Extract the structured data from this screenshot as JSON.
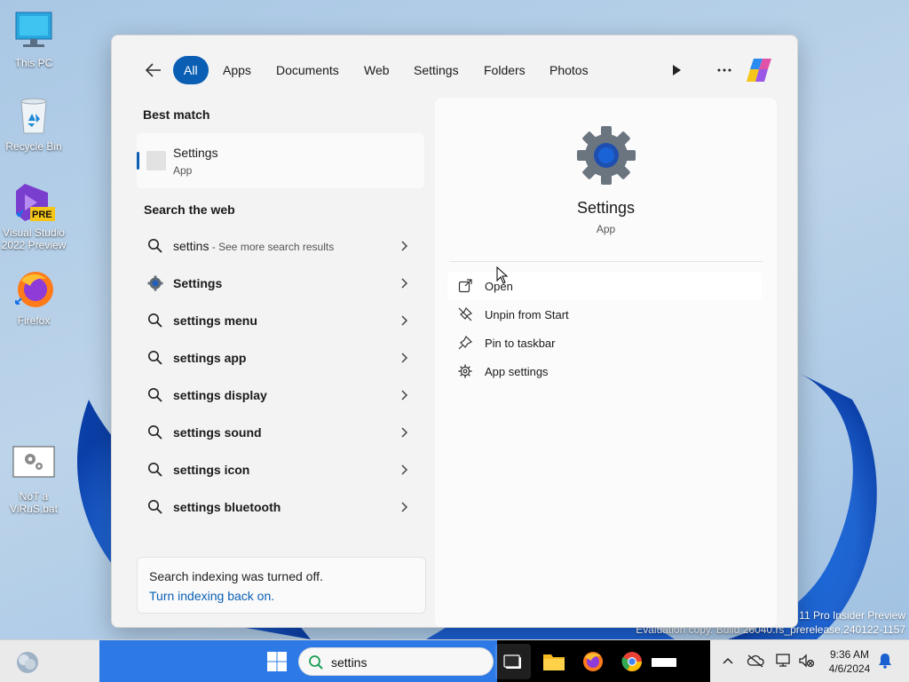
{
  "desktop": {
    "icons": [
      {
        "label": "This PC",
        "icon": "monitor-icon"
      },
      {
        "label": "Recycle Bin",
        "icon": "recycle-bin-icon"
      },
      {
        "label": "Visual Studio\n2022 Preview",
        "icon": "visual-studio-icon",
        "badge": "PRE"
      },
      {
        "label": "Firefox",
        "icon": "firefox-icon"
      },
      {
        "label": "NoT a\nViRuS.bat",
        "icon": "batch-file-icon"
      }
    ]
  },
  "search": {
    "filters": [
      "All",
      "Apps",
      "Documents",
      "Web",
      "Settings",
      "Folders",
      "Photos"
    ],
    "active_filter": "All",
    "best_match_title": "Best match",
    "best_match": {
      "name": "Settings",
      "type": "App"
    },
    "web_title": "Search the web",
    "web_results": [
      {
        "query": "settins",
        "hint": " - See more search results",
        "icon": "search-icon"
      },
      {
        "text": "Settings",
        "icon": "settings-gear-icon"
      },
      {
        "text": "settings menu",
        "icon": "search-icon"
      },
      {
        "text": "settings app",
        "icon": "search-icon"
      },
      {
        "text": "settings display",
        "icon": "search-icon"
      },
      {
        "text": "settings sound",
        "icon": "search-icon"
      },
      {
        "text": "settings icon",
        "icon": "search-icon"
      },
      {
        "text": "settings bluetooth",
        "icon": "search-icon"
      }
    ],
    "indexing": {
      "message": "Search indexing was turned off.",
      "link": "Turn indexing back on."
    },
    "preview": {
      "name": "Settings",
      "type": "App",
      "actions": [
        {
          "label": "Open",
          "icon": "open-external-icon"
        },
        {
          "label": "Unpin from Start",
          "icon": "unpin-icon"
        },
        {
          "label": "Pin to taskbar",
          "icon": "pin-icon"
        },
        {
          "label": "App settings",
          "icon": "gear-icon"
        }
      ]
    }
  },
  "watermark": {
    "line1": "11 Pro Insider Preview",
    "line2": "Evaluation copy. Build 26040.rs_prerelease.240122-1157"
  },
  "taskbar": {
    "search_value": "settins",
    "time": "9:36 AM",
    "date": "4/6/2024"
  },
  "colors": {
    "accent": "#0a5fb4",
    "taskbar_blue": "#2d7ae6"
  }
}
